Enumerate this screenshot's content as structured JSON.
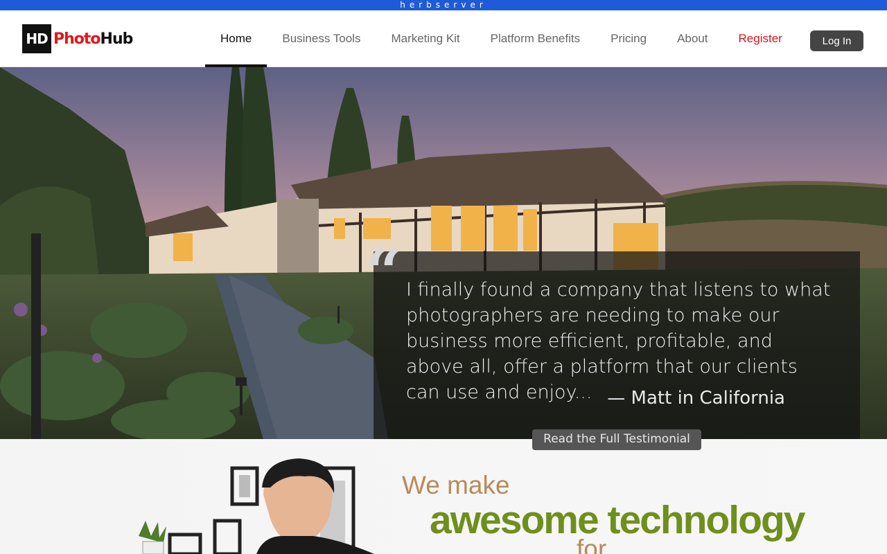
{
  "topbar": {
    "text": "herbserver"
  },
  "brand": {
    "hd": "HD",
    "photo": "Photo",
    "hub": "Hub"
  },
  "nav": {
    "items": [
      "Home",
      "Business Tools",
      "Marketing Kit",
      "Platform Benefits",
      "Pricing",
      "About"
    ],
    "register": "Register",
    "login": "Log In"
  },
  "hero": {
    "quote_mark": "“",
    "quote": "I finally found a company that listens to what photographers are needing to make our business more efficient, profitable, and above all, offer a platform that our clients can use and enjoy...",
    "author": "— Matt in California",
    "button": "Read the Full Testimonial"
  },
  "promo": {
    "line1": "We make",
    "line2": "awesome technology",
    "line3": "for"
  },
  "colors": {
    "topbar": "#1f5bd8",
    "register": "#d6141a",
    "brand_red": "#e3171a",
    "tagline_tan": "#b88a5a",
    "tagline_green": "#6f8f1c"
  }
}
